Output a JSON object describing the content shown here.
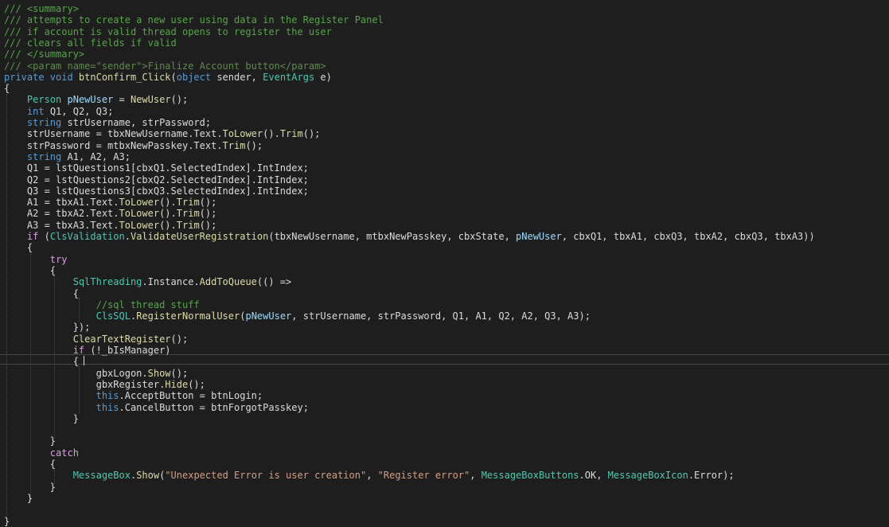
{
  "colors": {
    "background": "#1e1e1e",
    "default": "#dcdcdc",
    "comment": "#57a64a",
    "xmldoc": "#608b4e",
    "keyword": "#569cd6",
    "control": "#d8a0df",
    "type": "#4ec9b0",
    "method": "#dcdcaa",
    "string": "#d69d85",
    "variable": "#9cdcfe"
  },
  "lines": [
    [
      {
        "t": "comment",
        "s": "/// <summary>"
      }
    ],
    [
      {
        "t": "comment",
        "s": "/// attempts to create a new user using data in the Register Panel"
      }
    ],
    [
      {
        "t": "comment",
        "s": "/// if account is valid thread opens to register the user"
      }
    ],
    [
      {
        "t": "comment",
        "s": "/// clears all fields if valid"
      }
    ],
    [
      {
        "t": "comment",
        "s": "/// </summary>"
      }
    ],
    [
      {
        "t": "xmldoc",
        "s": "/// <param name=\"sender\">Finalize Account button</param>"
      }
    ],
    [
      {
        "t": "keyword",
        "s": "private void "
      },
      {
        "t": "method",
        "s": "btnConfirm_Click"
      },
      {
        "t": "default",
        "s": "("
      },
      {
        "t": "keyword",
        "s": "object"
      },
      {
        "t": "default",
        "s": " sender, "
      },
      {
        "t": "type",
        "s": "EventArgs"
      },
      {
        "t": "default",
        "s": " e)"
      }
    ],
    [
      {
        "t": "default",
        "s": "{"
      }
    ],
    [
      {
        "t": "default",
        "s": "    "
      },
      {
        "t": "type",
        "s": "Person"
      },
      {
        "t": "default",
        "s": " "
      },
      {
        "t": "variable",
        "s": "pNewUser"
      },
      {
        "t": "default",
        "s": " = "
      },
      {
        "t": "method",
        "s": "NewUser"
      },
      {
        "t": "default",
        "s": "();"
      }
    ],
    [
      {
        "t": "default",
        "s": "    "
      },
      {
        "t": "keyword",
        "s": "int"
      },
      {
        "t": "default",
        "s": " Q1, Q2, Q3;"
      }
    ],
    [
      {
        "t": "default",
        "s": "    "
      },
      {
        "t": "keyword",
        "s": "string"
      },
      {
        "t": "default",
        "s": " strUsername, strPassword;"
      }
    ],
    [
      {
        "t": "default",
        "s": "    strUsername = tbxNewUsername.Text."
      },
      {
        "t": "method",
        "s": "ToLower"
      },
      {
        "t": "default",
        "s": "()."
      },
      {
        "t": "method",
        "s": "Trim"
      },
      {
        "t": "default",
        "s": "();"
      }
    ],
    [
      {
        "t": "default",
        "s": "    strPassword = mtbxNewPasskey.Text."
      },
      {
        "t": "method",
        "s": "Trim"
      },
      {
        "t": "default",
        "s": "();"
      }
    ],
    [
      {
        "t": "default",
        "s": "    "
      },
      {
        "t": "keyword",
        "s": "string"
      },
      {
        "t": "default",
        "s": " A1, A2, A3;"
      }
    ],
    [
      {
        "t": "default",
        "s": "    Q1 = lstQuestions1[cbxQ1.SelectedIndex].IntIndex;"
      }
    ],
    [
      {
        "t": "default",
        "s": "    Q2 = lstQuestions2[cbxQ2.SelectedIndex].IntIndex;"
      }
    ],
    [
      {
        "t": "default",
        "s": "    Q3 = lstQuestions3[cbxQ3.SelectedIndex].IntIndex;"
      }
    ],
    [
      {
        "t": "default",
        "s": "    A1 = tbxA1.Text."
      },
      {
        "t": "method",
        "s": "ToLower"
      },
      {
        "t": "default",
        "s": "()."
      },
      {
        "t": "method",
        "s": "Trim"
      },
      {
        "t": "default",
        "s": "();"
      }
    ],
    [
      {
        "t": "default",
        "s": "    A2 = tbxA2.Text."
      },
      {
        "t": "method",
        "s": "ToLower"
      },
      {
        "t": "default",
        "s": "()."
      },
      {
        "t": "method",
        "s": "Trim"
      },
      {
        "t": "default",
        "s": "();"
      }
    ],
    [
      {
        "t": "default",
        "s": "    A3 = tbxA3.Text."
      },
      {
        "t": "method",
        "s": "ToLower"
      },
      {
        "t": "default",
        "s": "()."
      },
      {
        "t": "method",
        "s": "Trim"
      },
      {
        "t": "default",
        "s": "();"
      }
    ],
    [
      {
        "t": "default",
        "s": "    "
      },
      {
        "t": "control",
        "s": "if"
      },
      {
        "t": "default",
        "s": " ("
      },
      {
        "t": "type",
        "s": "ClsValidation"
      },
      {
        "t": "default",
        "s": "."
      },
      {
        "t": "method",
        "s": "ValidateUserRegistration"
      },
      {
        "t": "default",
        "s": "(tbxNewUsername, mtbxNewPasskey, cbxState, "
      },
      {
        "t": "variable",
        "s": "pNewUser"
      },
      {
        "t": "default",
        "s": ", cbxQ1, tbxA1, cbxQ3, tbxA2, cbxQ3, tbxA3))"
      }
    ],
    [
      {
        "t": "default",
        "s": "    {"
      }
    ],
    [
      {
        "t": "default",
        "s": "        "
      },
      {
        "t": "control",
        "s": "try"
      }
    ],
    [
      {
        "t": "default",
        "s": "        {"
      }
    ],
    [
      {
        "t": "default",
        "s": "            "
      },
      {
        "t": "type",
        "s": "SqlThreading"
      },
      {
        "t": "default",
        "s": ".Instance."
      },
      {
        "t": "method",
        "s": "AddToQueue"
      },
      {
        "t": "default",
        "s": "(() =>"
      }
    ],
    [
      {
        "t": "default",
        "s": "            {"
      }
    ],
    [
      {
        "t": "default",
        "s": "                "
      },
      {
        "t": "comment",
        "s": "//sql thread stuff"
      }
    ],
    [
      {
        "t": "default",
        "s": "                "
      },
      {
        "t": "type",
        "s": "ClsSQL"
      },
      {
        "t": "default",
        "s": "."
      },
      {
        "t": "method",
        "s": "RegisterNormalUser"
      },
      {
        "t": "default",
        "s": "("
      },
      {
        "t": "variable",
        "s": "pNewUser"
      },
      {
        "t": "default",
        "s": ", strUsername, strPassword, Q1, A1, Q2, A2, Q3, A3);"
      }
    ],
    [
      {
        "t": "default",
        "s": "            });"
      }
    ],
    [
      {
        "t": "default",
        "s": "            "
      },
      {
        "t": "method",
        "s": "ClearTextRegister"
      },
      {
        "t": "default",
        "s": "();"
      }
    ],
    [
      {
        "t": "default",
        "s": "            "
      },
      {
        "t": "control",
        "s": "if"
      },
      {
        "t": "default",
        "s": " (!_bIsManager)"
      }
    ],
    [
      {
        "t": "default",
        "s": "            {"
      }
    ],
    [
      {
        "t": "default",
        "s": "                gbxLogon."
      },
      {
        "t": "method",
        "s": "Show"
      },
      {
        "t": "default",
        "s": "();"
      }
    ],
    [
      {
        "t": "default",
        "s": "                gbxRegister."
      },
      {
        "t": "method",
        "s": "Hide"
      },
      {
        "t": "default",
        "s": "();"
      }
    ],
    [
      {
        "t": "default",
        "s": "                "
      },
      {
        "t": "keyword",
        "s": "this"
      },
      {
        "t": "default",
        "s": ".AcceptButton = btnLogin;"
      }
    ],
    [
      {
        "t": "default",
        "s": "                "
      },
      {
        "t": "keyword",
        "s": "this"
      },
      {
        "t": "default",
        "s": ".CancelButton = btnForgotPasskey;"
      }
    ],
    [
      {
        "t": "default",
        "s": "            }"
      }
    ],
    [
      {
        "t": "default",
        "s": ""
      }
    ],
    [
      {
        "t": "default",
        "s": "        }"
      }
    ],
    [
      {
        "t": "default",
        "s": "        "
      },
      {
        "t": "control",
        "s": "catch"
      }
    ],
    [
      {
        "t": "default",
        "s": "        {"
      }
    ],
    [
      {
        "t": "default",
        "s": "            "
      },
      {
        "t": "type",
        "s": "MessageBox"
      },
      {
        "t": "default",
        "s": "."
      },
      {
        "t": "method",
        "s": "Show"
      },
      {
        "t": "default",
        "s": "("
      },
      {
        "t": "string",
        "s": "\"Unexpected Error is user creation\""
      },
      {
        "t": "default",
        "s": ", "
      },
      {
        "t": "string",
        "s": "\"Register error\""
      },
      {
        "t": "default",
        "s": ", "
      },
      {
        "t": "type",
        "s": "MessageBoxButtons"
      },
      {
        "t": "default",
        "s": ".OK, "
      },
      {
        "t": "type",
        "s": "MessageBoxIcon"
      },
      {
        "t": "default",
        "s": ".Error);"
      }
    ],
    [
      {
        "t": "default",
        "s": "        }"
      }
    ],
    [
      {
        "t": "default",
        "s": "    }"
      }
    ],
    [
      {
        "t": "default",
        "s": ""
      }
    ],
    [
      {
        "t": "default",
        "s": "}"
      }
    ]
  ]
}
